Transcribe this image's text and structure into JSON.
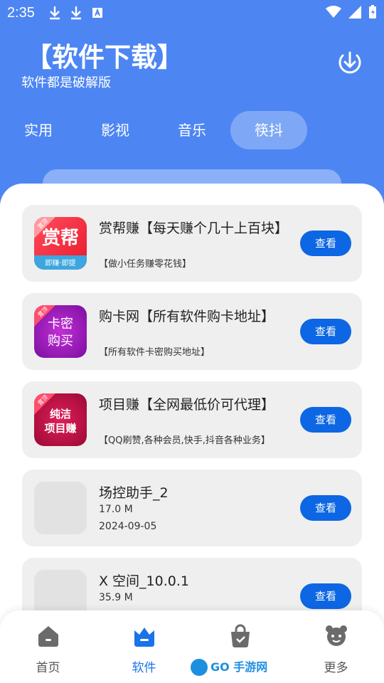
{
  "status_bar": {
    "time": "2:35"
  },
  "header": {
    "title": "【软件下载】",
    "subtitle": "软件都是破解版"
  },
  "tabs": [
    {
      "label": "实用"
    },
    {
      "label": "影视"
    },
    {
      "label": "音乐"
    },
    {
      "label": "筷抖"
    }
  ],
  "active_tab": "筷抖",
  "apps": [
    {
      "title": "赏帮赚【每天赚个几十上百块】",
      "desc": "【做小任务赚零花钱】",
      "icon_text": "赏帮",
      "icon_sub": "即赚·即提",
      "badge": "置顶",
      "button": "查看"
    },
    {
      "title": "购卡网【所有软件购卡地址】",
      "desc": "【所有软件卡密购买地址】",
      "icon_text_1": "卡密",
      "icon_text_2": "购买",
      "badge": "置顶",
      "button": "查看"
    },
    {
      "title": "项目赚【全网最低价可代理】",
      "desc": "【QQ刷赞,各种会员,快手,抖音各种业务】",
      "icon_text_1": "纯洁",
      "icon_text_2": "项目赚",
      "badge": "置顶",
      "button": "查看"
    },
    {
      "title": "场控助手_2",
      "size": "17.0 M",
      "date": "2024-09-05",
      "button": "查看"
    },
    {
      "title": "X 空间_10.0.1",
      "size": "35.9 M",
      "button": "查看"
    }
  ],
  "bottom_nav": [
    {
      "label": "首页"
    },
    {
      "label": "软件"
    },
    {
      "label": ""
    },
    {
      "label": "更多"
    }
  ],
  "watermark": "GO 手游网",
  "colors": {
    "primary": "#4d86f3",
    "button": "#0d66e3",
    "active_nav": "#1a73e8"
  }
}
